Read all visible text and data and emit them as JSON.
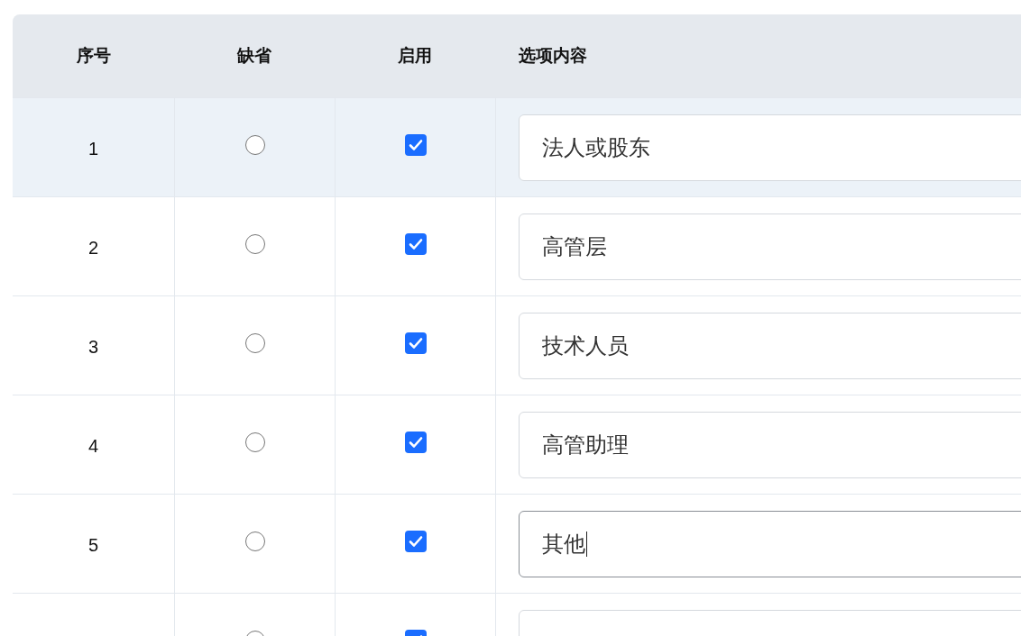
{
  "table": {
    "columns": [
      "序号",
      "缺省",
      "启用",
      "选项内容"
    ],
    "rows": [
      {
        "index": "1",
        "default_selected": false,
        "enabled": true,
        "value": "法人或股东",
        "highlighted": true,
        "focused": false
      },
      {
        "index": "2",
        "default_selected": false,
        "enabled": true,
        "value": "高管层",
        "highlighted": false,
        "focused": false
      },
      {
        "index": "3",
        "default_selected": false,
        "enabled": true,
        "value": "技术人员",
        "highlighted": false,
        "focused": false
      },
      {
        "index": "4",
        "default_selected": false,
        "enabled": true,
        "value": "高管助理",
        "highlighted": false,
        "focused": false
      },
      {
        "index": "5",
        "default_selected": false,
        "enabled": true,
        "value": "其他",
        "highlighted": false,
        "focused": true
      },
      {
        "default_selected": false,
        "enabled": true,
        "highlighted": false,
        "focused": false
      }
    ]
  }
}
